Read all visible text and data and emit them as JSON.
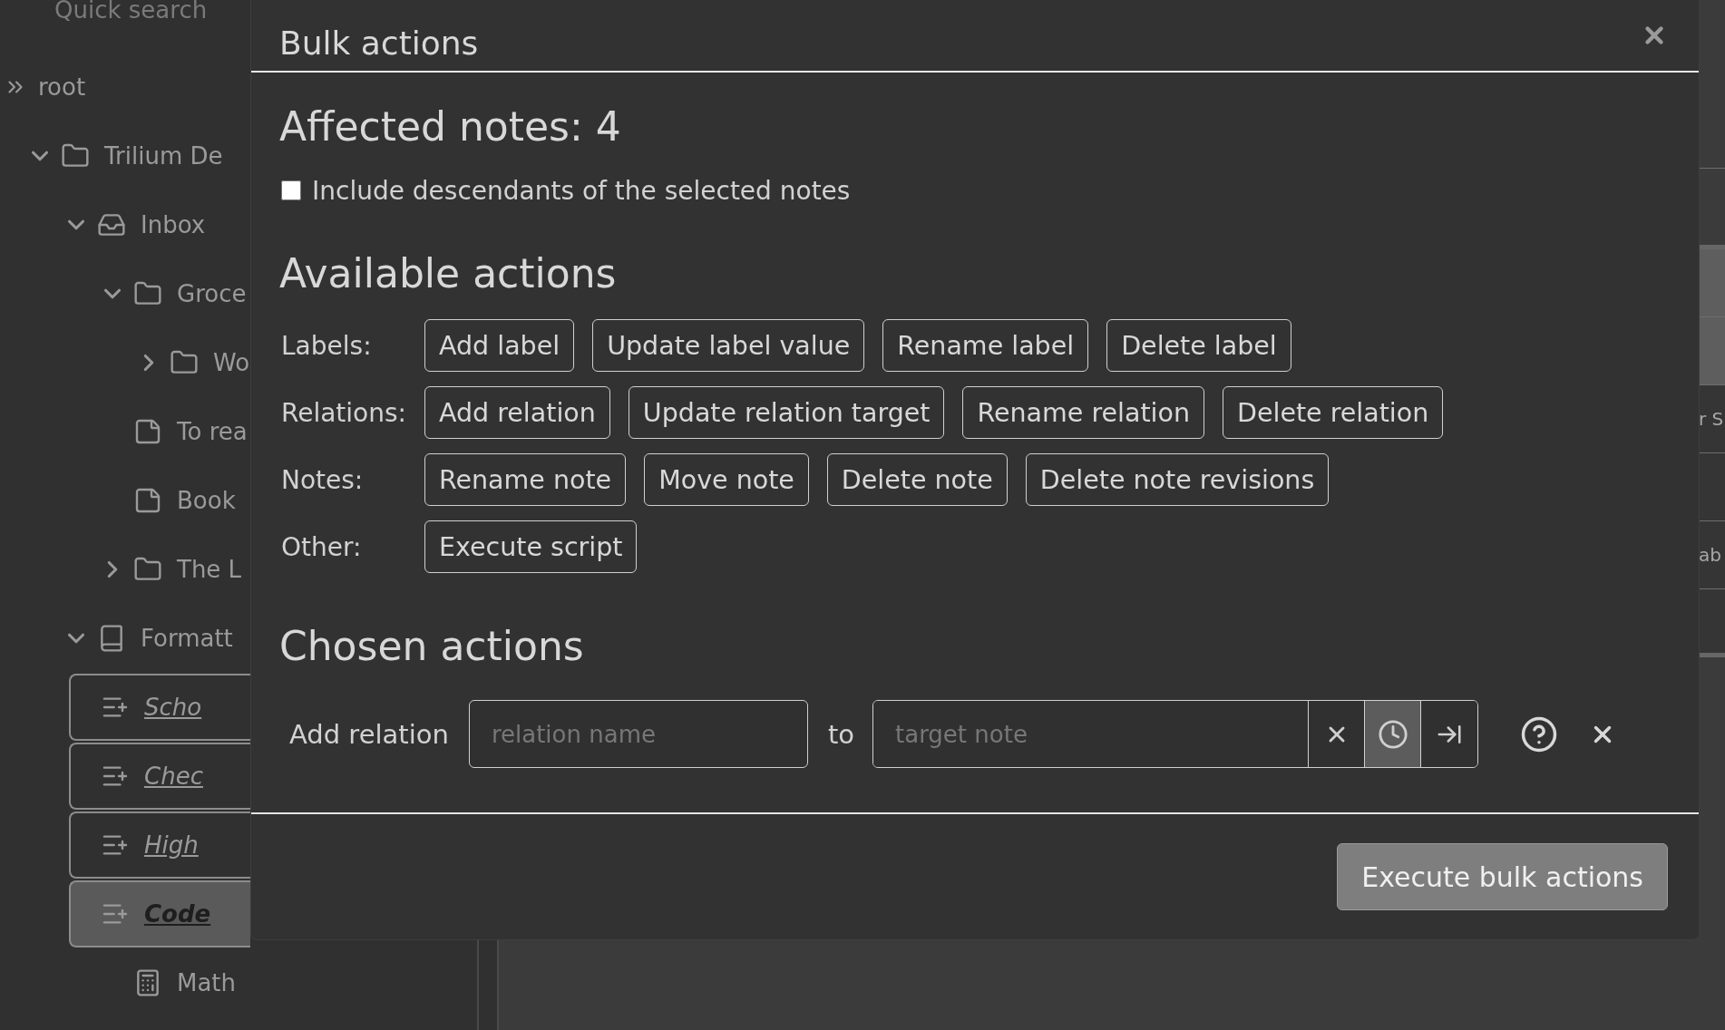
{
  "sidebar": {
    "search": {
      "placeholder": "Quick search"
    },
    "tree": [
      {
        "label": "root",
        "kind": "root",
        "children": [
          {
            "label": "Trilium De",
            "kind": "folder",
            "expanded": true,
            "children": [
              {
                "label": "Inbox",
                "kind": "inbox",
                "expanded": true,
                "children": [
                  {
                    "label": "Groce",
                    "kind": "folder",
                    "expanded": true,
                    "children": [
                      {
                        "label": "Wo",
                        "kind": "folder",
                        "expanded": false
                      }
                    ]
                  },
                  {
                    "label": "To rea",
                    "kind": "note"
                  },
                  {
                    "label": "Book",
                    "kind": "note"
                  },
                  {
                    "label": "The L",
                    "kind": "folder",
                    "expanded": false
                  }
                ]
              },
              {
                "label": "Formatt",
                "kind": "book",
                "expanded": true,
                "children": [
                  {
                    "label": "Scho",
                    "kind": "template",
                    "selected": true,
                    "active": false
                  },
                  {
                    "label": "Chec",
                    "kind": "template",
                    "selected": true,
                    "active": false
                  },
                  {
                    "label": "High",
                    "kind": "template",
                    "selected": true,
                    "active": false
                  },
                  {
                    "label": "Code",
                    "kind": "template",
                    "selected": true,
                    "active": true
                  },
                  {
                    "label": "Math",
                    "kind": "calc",
                    "selected": false,
                    "active": false
                  }
                ]
              }
            ]
          }
        ]
      }
    ]
  },
  "right_panel": {
    "rows": [
      {
        "highlighted": true
      },
      {
        "highlighted": true
      },
      {
        "label": "r S",
        "highlighted": false
      },
      {
        "highlighted": false
      },
      {
        "label": "ab",
        "highlighted": false
      },
      {
        "highlighted": false
      }
    ]
  },
  "dialog": {
    "title": "Bulk actions",
    "affected": "Affected notes: 4",
    "include_descendants": {
      "label": "Include descendants of the selected notes",
      "checked": false
    },
    "available_title": "Available actions",
    "groups": [
      {
        "label": "Labels:",
        "actions": [
          "Add label",
          "Update label value",
          "Rename label",
          "Delete label"
        ]
      },
      {
        "label": "Relations:",
        "actions": [
          "Add relation",
          "Update relation target",
          "Rename relation",
          "Delete relation"
        ]
      },
      {
        "label": "Notes:",
        "actions": [
          "Rename note",
          "Move note",
          "Delete note",
          "Delete note revisions"
        ]
      },
      {
        "label": "Other:",
        "actions": [
          "Execute script"
        ]
      }
    ],
    "chosen_title": "Chosen actions",
    "chosen": [
      {
        "kind": "add_relation",
        "label": "Add relation",
        "name_placeholder": "relation name",
        "connector": "to",
        "target_placeholder": "target note"
      }
    ],
    "execute_button": "Execute bulk actions"
  }
}
